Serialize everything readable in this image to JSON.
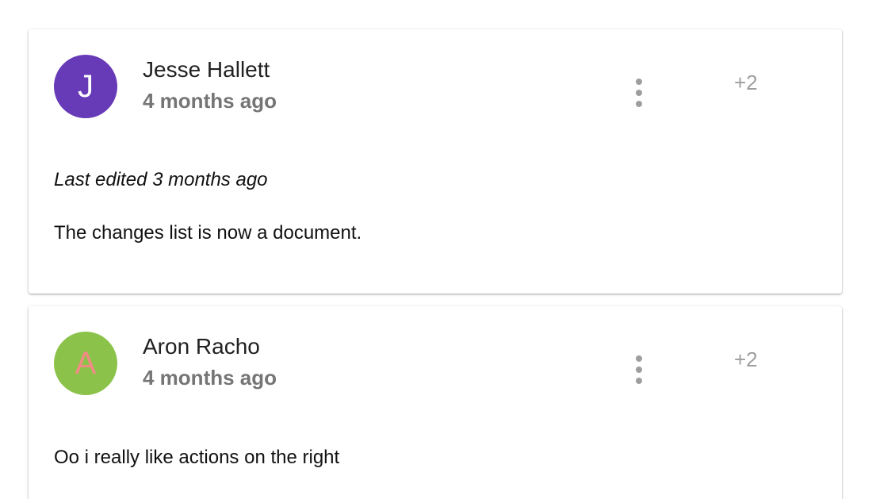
{
  "comments": [
    {
      "avatar_initial": "J",
      "avatar_bg": "#673ab7",
      "avatar_fg": "#ffffff",
      "author": "Jesse Hallett",
      "time": "4 months ago",
      "menu_icon": "more-vert-icon",
      "plus_label": "+2",
      "edited": "Last edited 3 months ago",
      "text": "The changes list is now a document."
    },
    {
      "avatar_initial": "A",
      "avatar_bg": "#8bc34a",
      "avatar_fg": "#f48a86",
      "author": "Aron Racho",
      "time": "4 months ago",
      "menu_icon": "more-vert-icon",
      "plus_label": "+2",
      "text": "Oo i really like actions on the right"
    }
  ]
}
